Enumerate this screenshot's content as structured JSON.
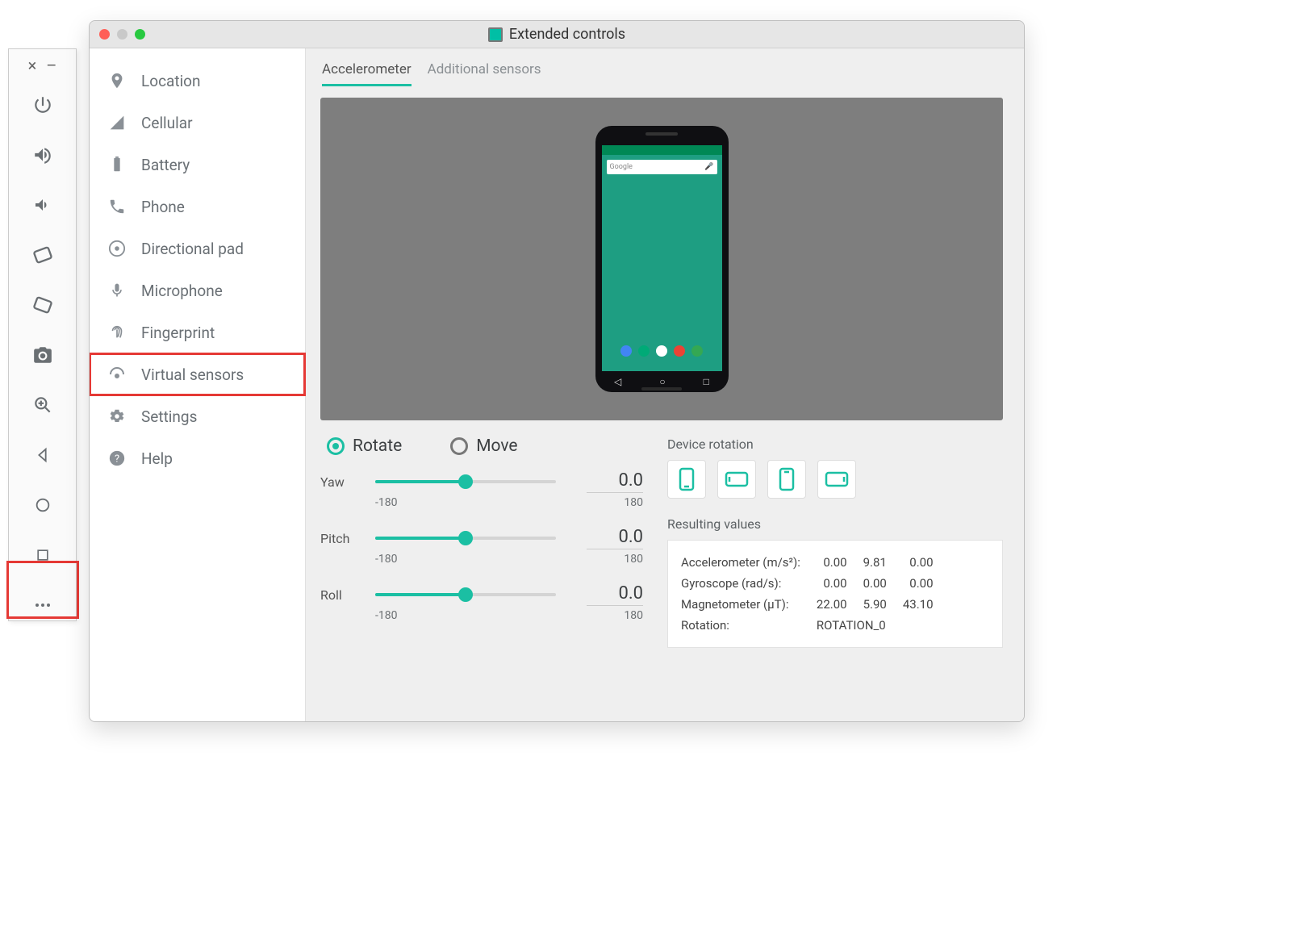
{
  "window": {
    "title": "Extended controls"
  },
  "sidebar": {
    "items": [
      {
        "label": "Location"
      },
      {
        "label": "Cellular"
      },
      {
        "label": "Battery"
      },
      {
        "label": "Phone"
      },
      {
        "label": "Directional pad"
      },
      {
        "label": "Microphone"
      },
      {
        "label": "Fingerprint"
      },
      {
        "label": "Virtual sensors"
      },
      {
        "label": "Settings"
      },
      {
        "label": "Help"
      }
    ]
  },
  "tabs": {
    "accelerometer": "Accelerometer",
    "additional": "Additional sensors"
  },
  "mode": {
    "rotate": "Rotate",
    "move": "Move"
  },
  "sliders": {
    "yaw": {
      "label": "Yaw",
      "min": "-180",
      "max": "180",
      "value": "0.0",
      "pct": 50
    },
    "pitch": {
      "label": "Pitch",
      "min": "-180",
      "max": "180",
      "value": "0.0",
      "pct": 50
    },
    "roll": {
      "label": "Roll",
      "min": "-180",
      "max": "180",
      "value": "0.0",
      "pct": 50
    }
  },
  "device_rotation_label": "Device rotation",
  "results": {
    "title": "Resulting values",
    "accel_label": "Accelerometer (m/s²):",
    "accel": [
      "0.00",
      "9.81",
      "0.00"
    ],
    "gyro_label": "Gyroscope (rad/s):",
    "gyro": [
      "0.00",
      "0.00",
      "0.00"
    ],
    "mag_label": "Magnetometer (µT):",
    "mag": [
      "22.00",
      "5.90",
      "43.10"
    ],
    "rot_label": "Rotation:",
    "rot_value": "ROTATION_0"
  },
  "phone_search": "Google"
}
